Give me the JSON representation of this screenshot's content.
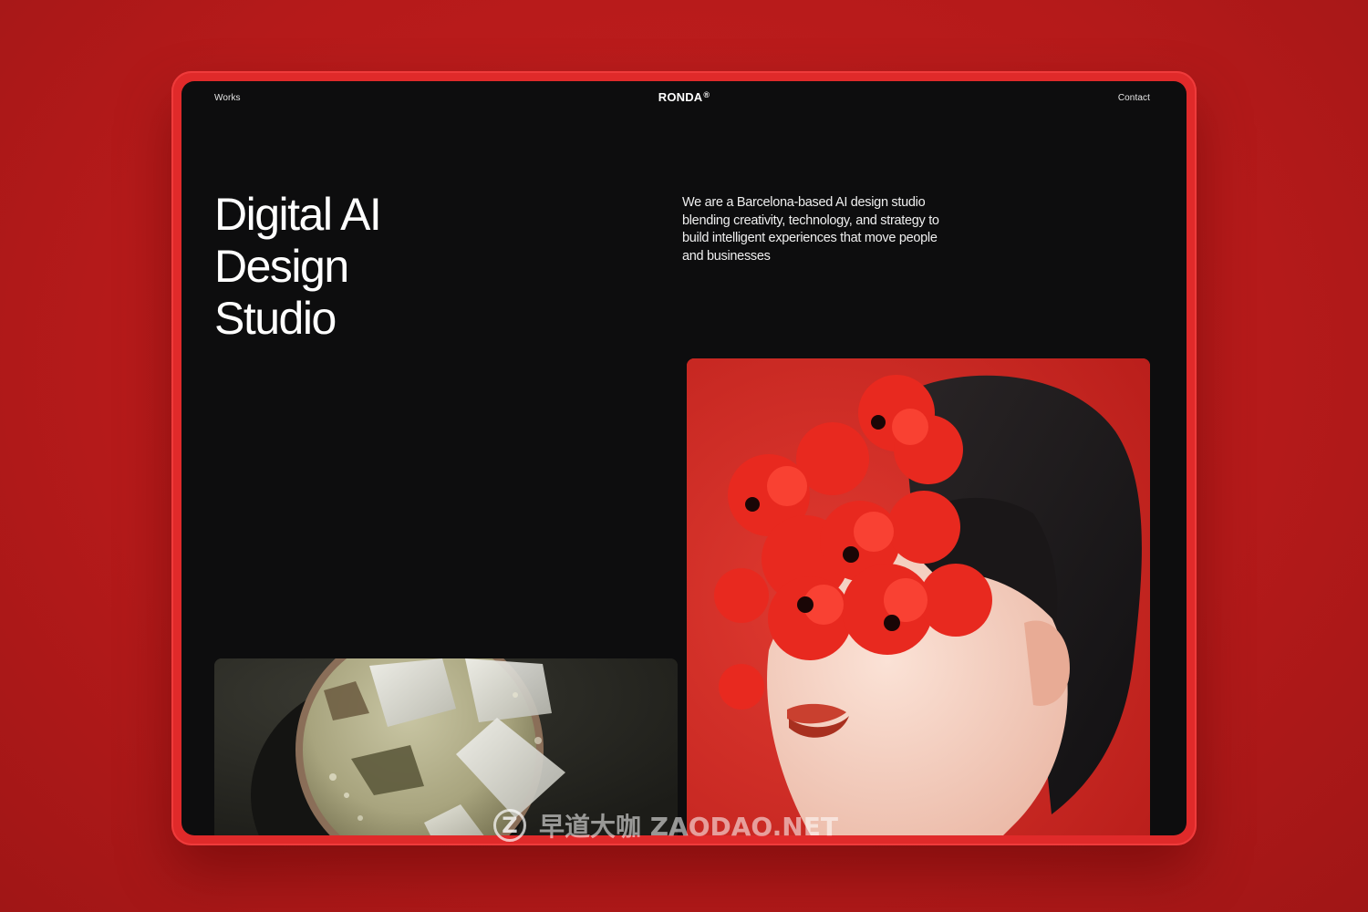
{
  "nav": {
    "works_label": "Works",
    "brand": "RONDA",
    "brand_mark": "®",
    "contact_label": "Contact"
  },
  "hero": {
    "title_lines": [
      "Digital AI",
      "Design",
      "Studio"
    ],
    "intro": "We are a Barcelona-based AI design studio blending creativity, technology, and strategy to build intelligent experiences that move people and businesses"
  },
  "images": {
    "drink_icon": "iced-drink-photo",
    "portrait_icon": "flower-portrait-photo"
  },
  "watermark": {
    "logo_letter": "Z",
    "text": "早道大咖 ZAODAO.NET"
  },
  "colors": {
    "background": "#b81c1c",
    "frame": "#e02a2a",
    "screen": "#0d0d0e",
    "text": "#ffffff"
  }
}
